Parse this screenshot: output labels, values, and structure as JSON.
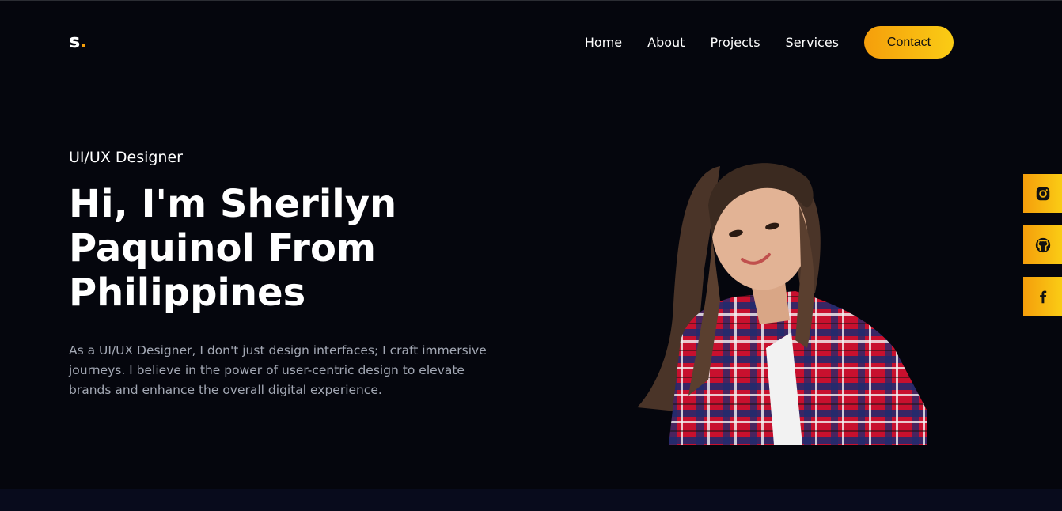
{
  "logo": {
    "letter": "s",
    "dot": "."
  },
  "nav": {
    "items": [
      {
        "label": "Home"
      },
      {
        "label": "About"
      },
      {
        "label": "Projects"
      },
      {
        "label": "Services"
      }
    ],
    "contact_label": "Contact"
  },
  "hero": {
    "subtitle": "UI/UX Designer",
    "title": "Hi, I'm Sherilyn Paquinol From Philippines",
    "description": "As a UI/UX Designer, I don't just design interfaces; I craft immersive journeys. I believe in the power of user-centric design to elevate brands and enhance the overall digital experience."
  },
  "socials": [
    {
      "icon": "instagram-icon"
    },
    {
      "icon": "github-icon"
    },
    {
      "icon": "facebook-icon"
    }
  ],
  "colors": {
    "background": "#05060d",
    "accent_start": "#f59e0b",
    "accent_end": "#facc15",
    "muted_text": "#a3a8b4"
  }
}
